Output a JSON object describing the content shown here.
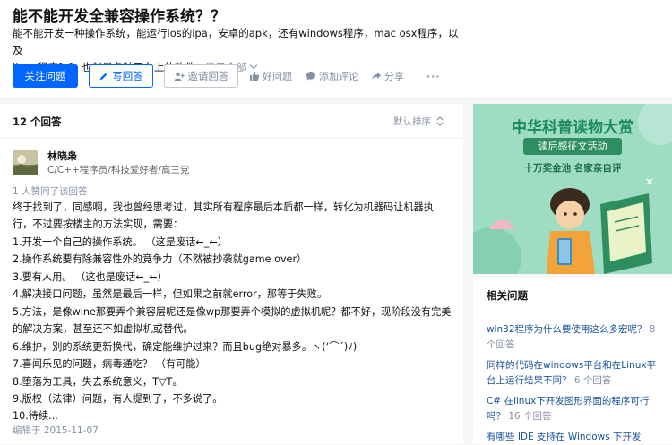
{
  "question": {
    "title": "能不能开发全兼容操作系统？？",
    "detail_lines": [
      "能不能开发一种操作系统，能运行ios的ipa，安卓的apk，还有windows程序，mac osx程序，以及",
      "linux程序？？ 也就是各种平台上的软件..."
    ],
    "show_all": "显示全部"
  },
  "actions": {
    "follow": "关注问题",
    "write_answer": "写回答",
    "invite": "邀请回答",
    "good_question": "好问题",
    "add_comment": "添加评论",
    "share": "分享",
    "more": "···"
  },
  "answers": {
    "count": "12 个回答",
    "sort": "默认排序"
  },
  "answer": {
    "author": "林晓枭",
    "bio": "C/C++程序员/科技爱好者/高三党",
    "votes": "1 人赞同了该回答",
    "lines": [
      "终于找到了，同感啊，我也曾经思考过，其实所有程序最后本质都一样，转化为机器码让机器执",
      "行，不过要按楼主的方法实现，需要：",
      "1.开发一个自己的操作系统。 （这是废话←_←）",
      "2.操作系统要有除兼容性外的竞争力（不然被抄袭就game over）",
      "3.要有人用。 （这也是废话←_←）",
      "4.解决接口问题，虽然是最后一样，但如果之前就error，那等于失败。",
      "5.方法，是像wine那要弄个兼容层呢还是像wp那要弄个模拟的虚拟机呢？都不好，现阶段没有完美",
      "的解决方案，甚至还不如虚拟机或替代。",
      "6.维护，别的系统更新换代，确定能维护过来？而且bug绝对暴多。ヽ(‘⌒´)ﾉ)",
      "7.喜闻乐见的问题，病毒通吃？ （有可能）",
      "8.堕落为工具，失去系统意义，T▽T。",
      "9.版权（法律）问题，有人提到了，不多说了。",
      "10.待续..."
    ],
    "edited": "编辑于 2015-11-07"
  },
  "banner": {
    "title": "中华科普读物大赏",
    "subtitle": "读后感征文活动",
    "tagline": "十万奖金池 名家亲自评",
    "bg_color": "#9fdcc4",
    "title_color": "#1a8a5c"
  },
  "related": {
    "title": "相关问题",
    "items": [
      {
        "q1": "win32程序为什么要使用这么多宏呢？",
        "q2": "",
        "c": "8 个回答"
      },
      {
        "q1": "同样的代码在windows平台和在Linux平",
        "q2": "台上运行结果不同？",
        "c": "6 个回答"
      },
      {
        "q1": "C# 在linux下开发图形界面的程序可行",
        "q2": "吗？",
        "c": "16 个回答"
      },
      {
        "q1": "有哪些 IDE 支持在 Windows 下开发",
        "q2": "",
        "c": ""
      }
    ]
  },
  "colors": {
    "brand": "#0066ff",
    "muted": "#8590a6",
    "link": "#175199"
  }
}
